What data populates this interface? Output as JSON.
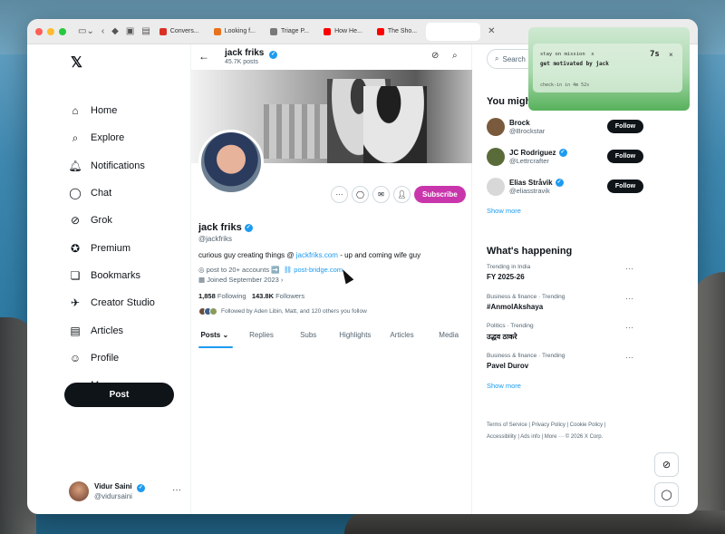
{
  "browser": {
    "tabs": [
      {
        "label": "Convers...",
        "color": "#d93025"
      },
      {
        "label": "Looking f...",
        "color": "#e8711c"
      },
      {
        "label": "Triage P...",
        "color": "#7a7a7a"
      },
      {
        "label": "How He...",
        "color": "#ff0000"
      },
      {
        "label": "The Sho...",
        "color": "#ff0000"
      }
    ]
  },
  "sidebar": {
    "logo": "𝕏",
    "items": [
      {
        "label": "Home",
        "icon": "⌂"
      },
      {
        "label": "Explore",
        "icon": "⌕"
      },
      {
        "label": "Notifications",
        "icon": "🔔︎"
      },
      {
        "label": "Chat",
        "icon": "◯"
      },
      {
        "label": "Grok",
        "icon": "⊘"
      },
      {
        "label": "Premium",
        "icon": "✪"
      },
      {
        "label": "Bookmarks",
        "icon": "❏"
      },
      {
        "label": "Creator Studio",
        "icon": "✈"
      },
      {
        "label": "Articles",
        "icon": "▤"
      },
      {
        "label": "Profile",
        "icon": "☺"
      },
      {
        "label": "More",
        "icon": "⋯"
      }
    ],
    "post_button": "Post",
    "account": {
      "name": "Vidur Saini",
      "handle": "@vidursaini",
      "more": "···"
    }
  },
  "profile": {
    "header_name": "jack friks",
    "post_count": "45.7K posts",
    "display_name": "jack friks",
    "handle": "@jackfriks",
    "bio_pre": "curious guy creating things @ ",
    "bio_link": "jackfriks.com",
    "bio_post": " - up and coming wife guy",
    "meta_line1": "post to 20+ accounts ➡️",
    "meta_link": "post-bridge.com",
    "joined": "Joined September 2023 ›",
    "following_count": "1,858",
    "following_label": " Following",
    "followers_count": "143.8K",
    "followers_label": " Followers",
    "followed_by": "Followed by Aden Libin, Matt, and 120 others you follow",
    "subscribe": "Subscribe",
    "tabs": [
      "Posts ⌄",
      "Replies",
      "Subs",
      "Highlights",
      "Articles",
      "Media"
    ]
  },
  "right": {
    "search_placeholder": "Search",
    "who_title": "You might like",
    "who": [
      {
        "name": "Brock",
        "handle": "@Brockstar",
        "verified": false
      },
      {
        "name": "JC Rodriguez",
        "handle": "@Lettrcrafter",
        "verified": true
      },
      {
        "name": "Elias Stråvik",
        "handle": "@eliasstravik",
        "verified": true
      }
    ],
    "follow_label": "Follow",
    "show_more": "Show more",
    "happening_title": "What's happening",
    "trends": [
      {
        "category": "Trending in India",
        "title": "FY 2025-26"
      },
      {
        "category": "Business & finance · Trending",
        "title": "#AnmolAkshaya"
      },
      {
        "category": "Politics · Trending",
        "title": "उद्धव ठाकरे"
      },
      {
        "category": "Business & finance · Trending",
        "title": "Pavel Durov"
      }
    ],
    "show_more2": "Show more",
    "footer_line1": "Terms of Service  |  Privacy Policy  |  Cookie Policy  |",
    "footer_line2": "Accessibility  |  Ads info  |  More ···  © 2026 X Corp."
  },
  "widget": {
    "label": "stay on mission",
    "close_small": "x",
    "text": "get motivated by jack",
    "checkin": "check-in in 4m 52s",
    "timer": "7s",
    "close": "×"
  }
}
